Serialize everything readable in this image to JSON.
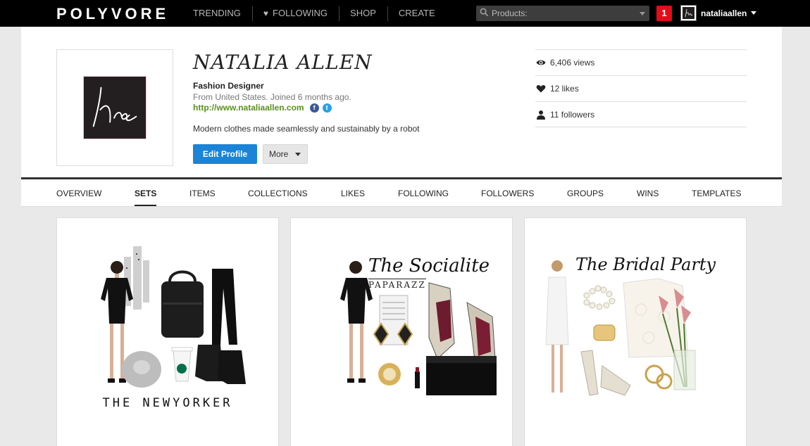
{
  "topbar": {
    "logo": "POLYVORE",
    "nav": [
      "TRENDING",
      "FOLLOWING",
      "SHOP",
      "CREATE"
    ],
    "search_placeholder": "Products:",
    "notifications": "1",
    "username": "nataliaallen"
  },
  "profile": {
    "name": "NATALIA ALLEN",
    "title": "Fashion Designer",
    "location": "From United States. Joined 6 months ago.",
    "website": "http://www.nataliaallen.com",
    "bio": "Modern clothes made seamlessly and sustainably by a robot",
    "edit_label": "Edit Profile",
    "more_label": "More",
    "stats": {
      "views": "6,406 views",
      "likes": "12 likes",
      "followers": "11 followers"
    }
  },
  "tabs": [
    {
      "label": "OVERVIEW"
    },
    {
      "label": "SETS",
      "active": true
    },
    {
      "label": "ITEMS"
    },
    {
      "label": "COLLECTIONS"
    },
    {
      "label": "LIKES"
    },
    {
      "label": "FOLLOWING"
    },
    {
      "label": "FOLLOWERS"
    },
    {
      "label": "GROUPS"
    },
    {
      "label": "WINS"
    },
    {
      "label": "TEMPLATES"
    }
  ],
  "sets": [
    {
      "title": "THE NEWYORKER"
    },
    {
      "title": "The Socialite",
      "subtitle": "PAPARAZZ"
    },
    {
      "title": "The Bridal Party"
    }
  ],
  "colors": {
    "topbar": "#000000",
    "edit_button": "#1b84d6",
    "link": "#5b8f1e",
    "notification": "#e20d1b"
  }
}
